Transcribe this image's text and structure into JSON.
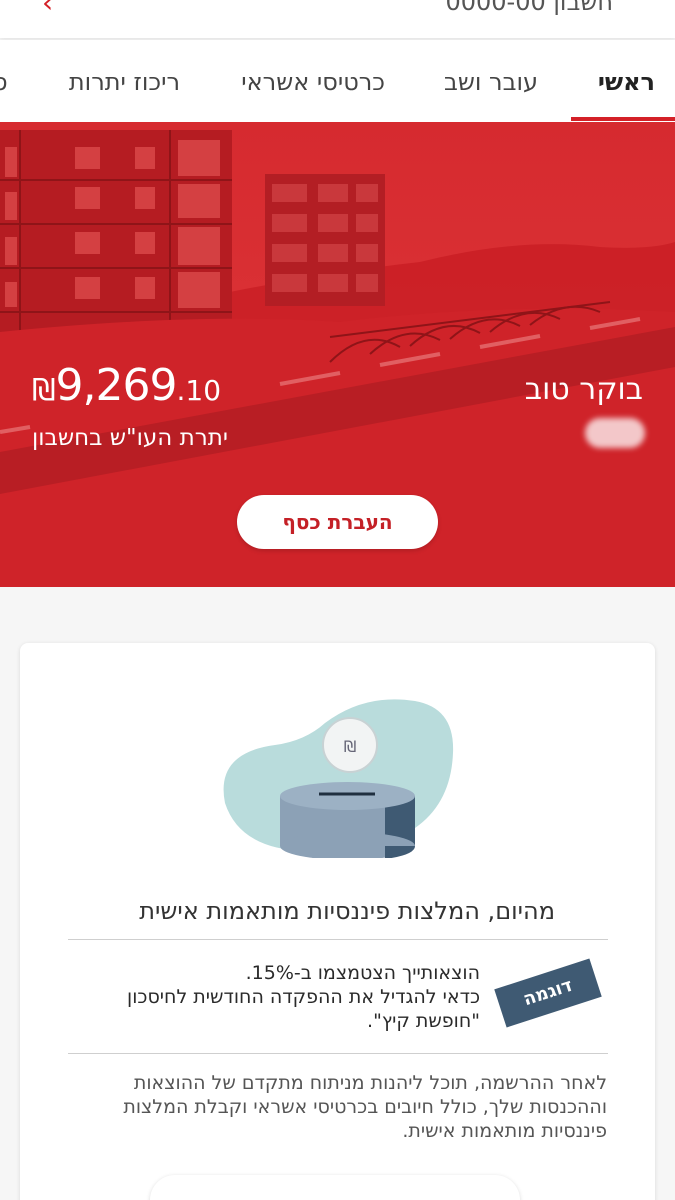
{
  "header": {
    "back_icon": "chevron-left-icon",
    "cut_title": "חשבון 0000-00"
  },
  "tabs": [
    {
      "label": "ראשי",
      "active": true
    },
    {
      "label": "עובר ושב",
      "active": false
    },
    {
      "label": "כרטיסי אשראי",
      "active": false
    },
    {
      "label": "ריכוז יתרות",
      "active": false
    },
    {
      "label": "ס",
      "active": false
    }
  ],
  "hero": {
    "greeting": "בוקר טוב",
    "balance_currency": "₪",
    "balance_main": "9,269",
    "balance_cents": ".10",
    "balance_label": "יתרת העו\"ש בחשבון",
    "transfer_button": "העברת כסף"
  },
  "card": {
    "coin_symbol": "₪",
    "title": "מהיום, המלצות פיננסיות מותאמות אישית",
    "example_badge": "דוגמה",
    "example_lines": [
      "הוצאותייך הצטמצמו ב-15%.",
      "כדאי להגדיל את ההפקדה החודשית לחיסכון",
      "\"חופשת קיץ\"."
    ],
    "description": "לאחר ההרשמה, תוכל ליהנות מניתוח מתקדם של ההוצאות וההכנסות שלך, כולל חיובים בכרטיסי אשראי וקבלת המלצות פיננסיות מותאמות אישית."
  },
  "colors": {
    "brand_red": "#d92228",
    "badge": "#3f5a73",
    "text": "#333333"
  }
}
